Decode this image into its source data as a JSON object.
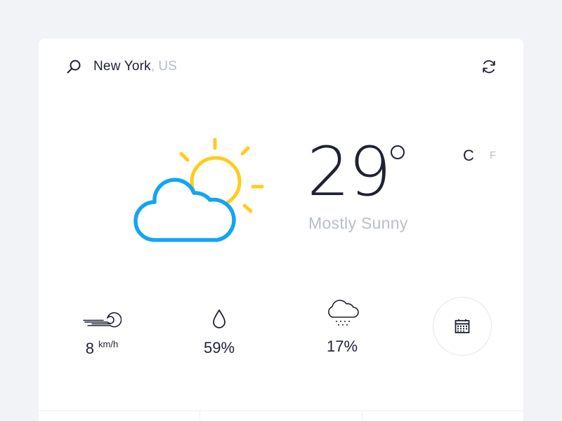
{
  "location": {
    "city": "New York",
    "country": ", US"
  },
  "current": {
    "temperature": "29",
    "condition": "Mostly Sunny",
    "units": {
      "celsius": "C",
      "fahrenheit": "F",
      "selected": "C"
    }
  },
  "stats": {
    "wind": {
      "value": "8",
      "unit": "km/h"
    },
    "humidity": {
      "value": "59%"
    },
    "precipitation": {
      "value": "17%"
    }
  },
  "colors": {
    "sun": "#ffcc1a",
    "cloud": "#12a5f4",
    "text": "#1f2235",
    "muted": "#b7bcc7"
  },
  "icons": [
    "search-icon",
    "refresh-icon",
    "partly-sunny-icon",
    "wind-icon",
    "droplet-icon",
    "snow-cloud-icon",
    "calendar-icon"
  ]
}
